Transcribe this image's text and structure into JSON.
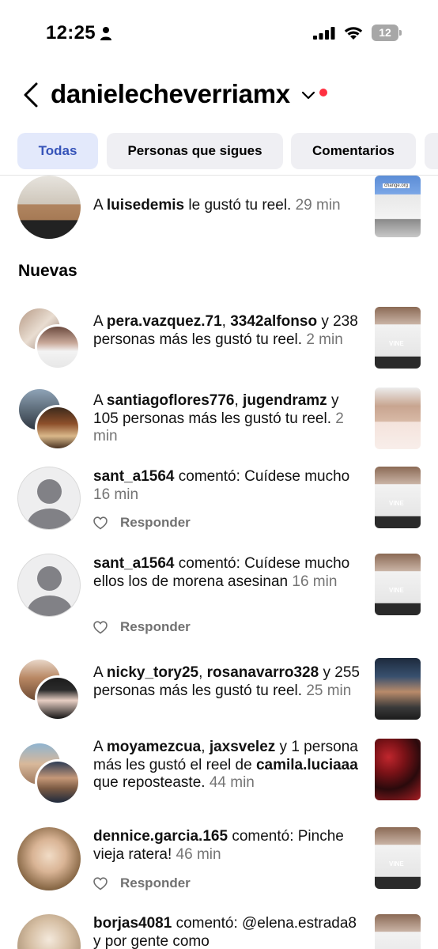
{
  "status_bar": {
    "time": "12:25",
    "battery": "12"
  },
  "header": {
    "username": "danielecheverriamx"
  },
  "tabs": [
    {
      "label": "Todas",
      "active": true
    },
    {
      "label": "Personas que sigues",
      "active": false
    },
    {
      "label": "Comentarios",
      "active": false
    }
  ],
  "reply_label": "Responder",
  "top_notification": {
    "prefix": "A ",
    "user": "luisedemis",
    "text": " le gustó tu reel. ",
    "time": "29 min"
  },
  "section_new": "Nuevas",
  "notifications": [
    {
      "p1": "A ",
      "u1": "pera.vazquez.71",
      "p2": ", ",
      "u2": "3342alfonso",
      "p3": " y 238 personas más les gustó tu reel. ",
      "time": "2 min"
    },
    {
      "p1": "A ",
      "u1": "santiagoflores776",
      "p2": ", ",
      "u2": "jugendramz",
      "p3": " y 105 personas más les gustó tu reel. ",
      "time": "2 min"
    },
    {
      "user": "sant_a1564",
      "text": " comentó: Cuídese mucho ",
      "time": "16 min"
    },
    {
      "user": "sant_a1564",
      "text": " comentó: Cuídese mucho ellos los de morena asesinan ",
      "time": "16 min"
    },
    {
      "p1": "A ",
      "u1": "nicky_tory25",
      "p2": ", ",
      "u2": "rosanavarro328",
      "p3": " y 255 personas más les gustó tu reel. ",
      "time": "25 min"
    },
    {
      "p1": "A ",
      "u1": "moyamezcua",
      "p2": ", ",
      "u2": "jaxsvelez",
      "p3": " y 1 persona más les gustó el reel de ",
      "u3": "camila.luciaaa",
      "p4": " que reposteaste. ",
      "time": "44 min"
    },
    {
      "user": "dennice.garcia.165",
      "text": " comentó: Pinche vieja ratera! ",
      "time": "46 min"
    },
    {
      "user": "borjas4081",
      "text": " comentó: @elena.estrada8 y por gente como"
    }
  ],
  "thumb_labels": {
    "vine": "VINE",
    "change": "change.org"
  },
  "colors": {
    "active_tab_bg": "#e3e9fb",
    "active_tab_text": "#3654b9",
    "tab_bg": "#efeff3",
    "notification_dot": "#ff3040",
    "muted_text": "#747474"
  }
}
